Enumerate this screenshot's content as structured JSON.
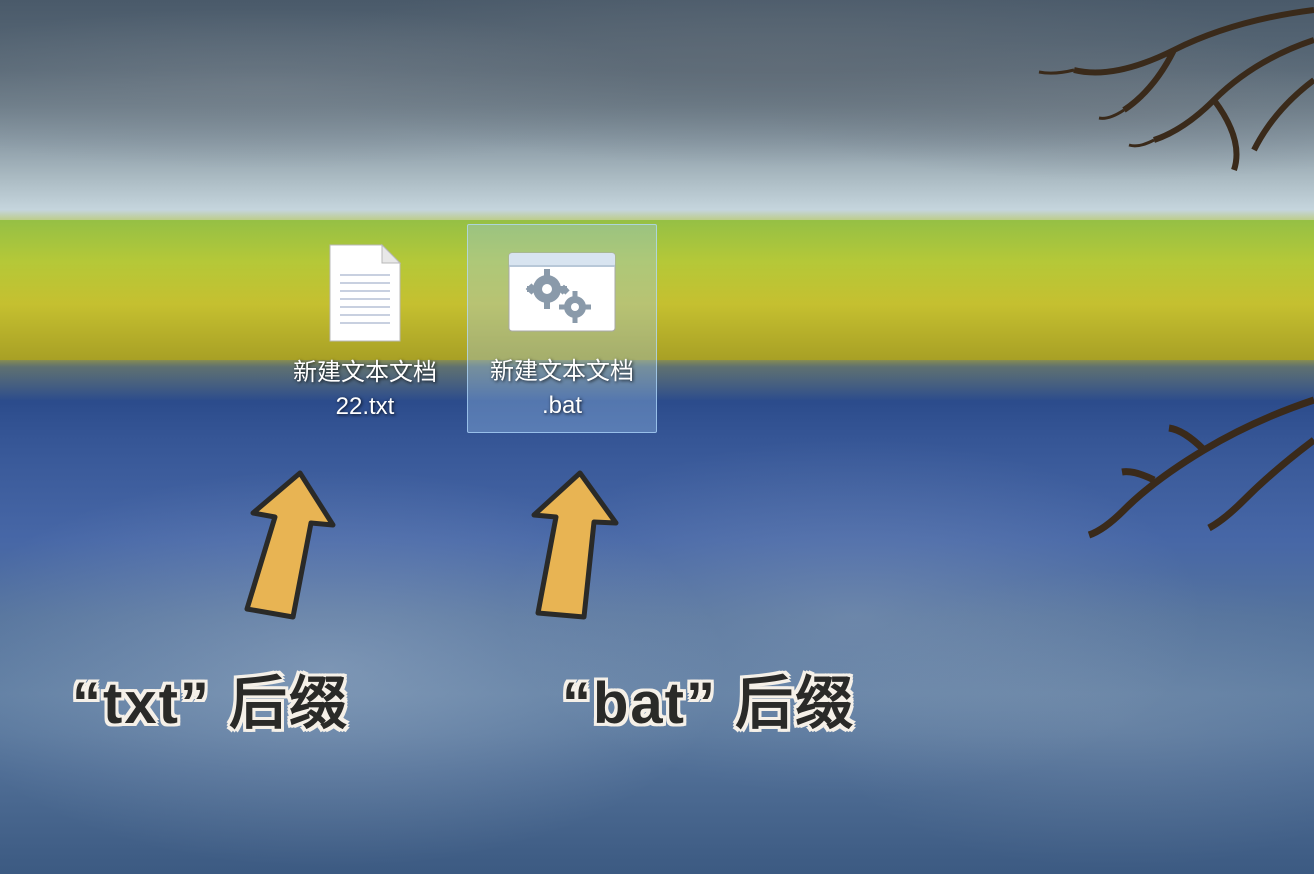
{
  "desktop": {
    "icons": [
      {
        "filename": "新建文本文档\n22.txt",
        "type": "txt",
        "selected": false
      },
      {
        "filename": "新建文本文档\n.bat",
        "type": "bat",
        "selected": true
      }
    ]
  },
  "annotations": {
    "left": "“txt” 后缀",
    "right": "“bat” 后缀"
  },
  "colors": {
    "arrow_fill": "#e8b453",
    "arrow_stroke": "#2a2a28",
    "selection_bg": "rgba(160,200,240,0.35)",
    "selection_border": "rgba(180,220,255,0.7)"
  }
}
